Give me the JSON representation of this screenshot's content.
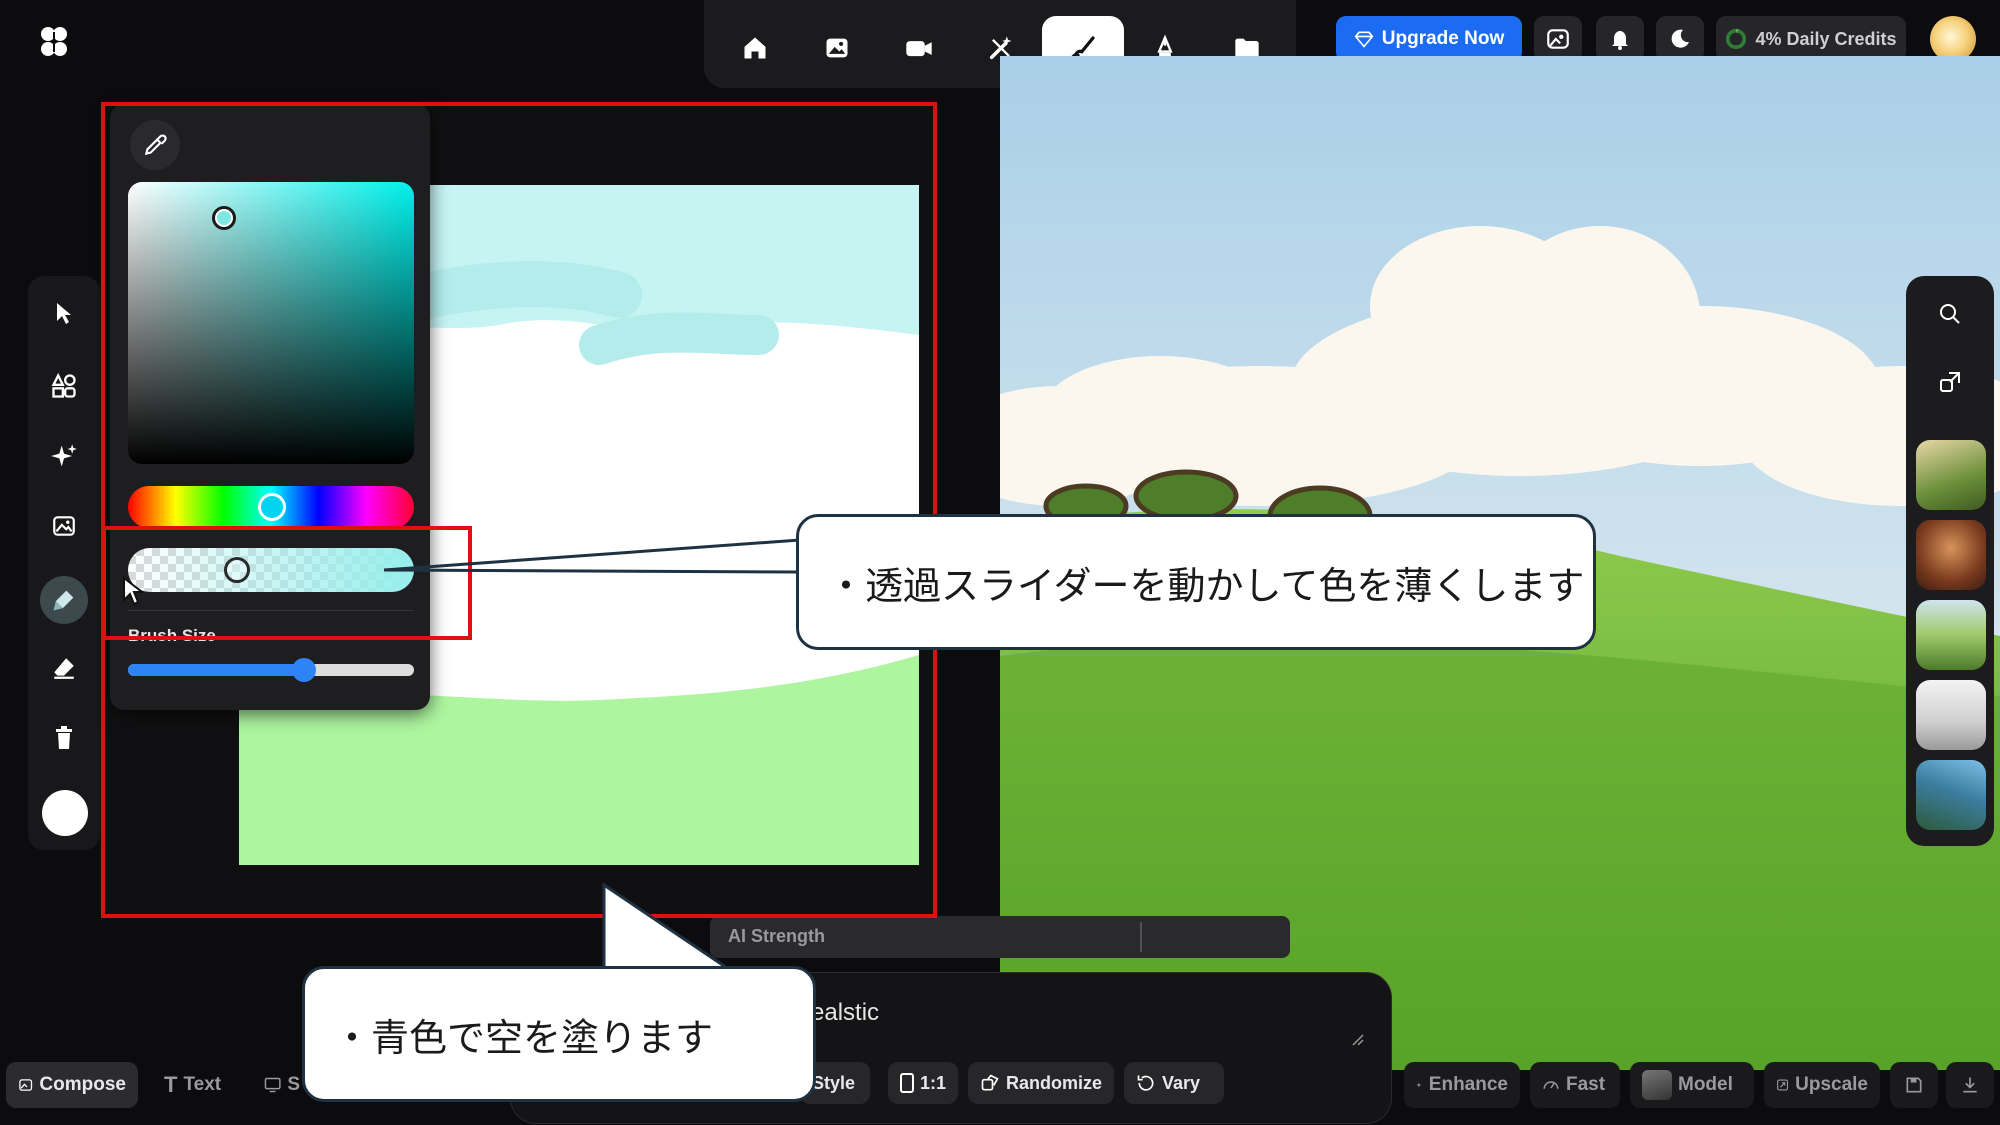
{
  "topbar": {
    "modes": [
      "home-icon",
      "image-icon",
      "video-icon",
      "magic-wand-icon",
      "brush-icon",
      "pen-icon",
      "folder-icon"
    ],
    "active_mode": "brush-icon",
    "upgrade_label": "Upgrade Now",
    "credits_label": "4% Daily Credits",
    "accent": "#1b6cf2"
  },
  "left_toolbar": {
    "tools": [
      "cursor-icon",
      "shapes-icon",
      "sparkle-icon",
      "image-icon",
      "brush-icon",
      "eraser-icon",
      "trash-icon"
    ],
    "active_tool": "brush-icon",
    "current_color": "#ffffff"
  },
  "color_picker": {
    "hue_value": "#00d4f0",
    "selected_color": "#96eeec",
    "brush_size_label": "Brush Size",
    "brush_size_fraction": 0.6,
    "opacity_fraction": 0.3
  },
  "ai_strength": {
    "label": "AI Strength"
  },
  "prompt": {
    "text": "ealstic"
  },
  "prompt_actions": {
    "style": "Style",
    "ratio": "1:1",
    "randomize": "Randomize",
    "vary": "Vary"
  },
  "bottom_left": {
    "compose": "Compose",
    "text": "Text",
    "third": "S"
  },
  "bottom_right": {
    "enhance": "Enhance",
    "fast": "Fast",
    "model": "Model",
    "upscale": "Upscale"
  },
  "annotations": {
    "callout_opacity": "・透過スライダーを動かして色を薄くします",
    "callout_sky": "・青色で空を塗ります",
    "highlight_color": "#e01010"
  }
}
